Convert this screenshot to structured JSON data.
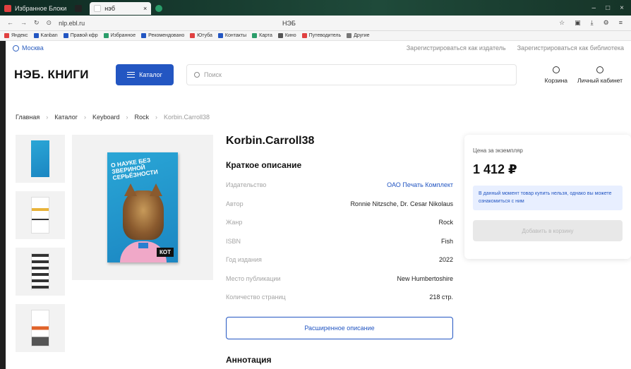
{
  "browser": {
    "tabs": [
      {
        "label": "Избранное Блоки",
        "favicon_color": "#e04040"
      },
      {
        "label": "",
        "favicon_color": "#222222"
      },
      {
        "label": "нэб",
        "favicon_color": "#ffffff"
      },
      {
        "label": "",
        "favicon_color": "#2a9d6a"
      }
    ],
    "url": "nlp.ebl.ru",
    "page_title": "НЭБ",
    "bookmarks": [
      {
        "label": "Яндекс",
        "color": "#e04040"
      },
      {
        "label": "Kanban",
        "color": "#2356c2"
      },
      {
        "label": "Правой кфр",
        "color": "#2356c2"
      },
      {
        "label": "Избранное",
        "color": "#2a9d6a"
      },
      {
        "label": "Рекомендовано",
        "color": "#2356c2"
      },
      {
        "label": "Ютуба",
        "color": "#e04040"
      },
      {
        "label": "Контакты",
        "color": "#2356c2"
      },
      {
        "label": "Карта",
        "color": "#2a9d6a"
      },
      {
        "label": "Кино",
        "color": "#555555"
      },
      {
        "label": "Путеводитель",
        "color": "#e04040"
      },
      {
        "label": "Другие",
        "color": "#777777"
      }
    ]
  },
  "topline": {
    "city": "Москва",
    "link_publisher": "Зарегистрироваться как издатель",
    "link_library": "Зарегистрироваться как библиотека"
  },
  "header": {
    "logo": "НЭБ. КНИГИ",
    "catalog": "Каталог",
    "search_placeholder": "Поиск",
    "cart": "Корзина",
    "account": "Личный кабинет"
  },
  "breadcrumb": [
    "Главная",
    "Каталог",
    "Keyboard",
    "Rock",
    "Korbin.Carroll38"
  ],
  "book": {
    "title": "Korbin.Carroll38",
    "cover_title": "О НАУКЕ БЕЗ ЗВЕРИНОЙ СЕРЬЁЗНОСТИ",
    "cover_badge": "КОТ",
    "brief_heading": "Краткое описание",
    "props": [
      {
        "key": "Издательство",
        "value": "ОАО Печать Комплект",
        "link": true
      },
      {
        "key": "Автор",
        "value": "Ronnie Nitzsche, Dr. Cesar Nikolaus",
        "link": false
      },
      {
        "key": "Жанр",
        "value": "Rock",
        "link": false
      },
      {
        "key": "ISBN",
        "value": "Fish",
        "link": false
      },
      {
        "key": "Год издания",
        "value": "2022",
        "link": false
      },
      {
        "key": "Место публикации",
        "value": "New Humbertoshire",
        "link": false
      },
      {
        "key": "Количество страниц",
        "value": "218 стр.",
        "link": false
      }
    ],
    "extended_button": "Расширенное описание",
    "annotation_heading": "Аннотация"
  },
  "price_card": {
    "label": "Цена за экземпляр",
    "price": "1 412 ₽",
    "note": "В данный момент товар купить нельзя, однако вы можете ознакомиться с ним",
    "buy_button": "Добавить в корзину"
  },
  "colors": {
    "accent": "#2356c2",
    "note_bg": "#e8efff"
  }
}
